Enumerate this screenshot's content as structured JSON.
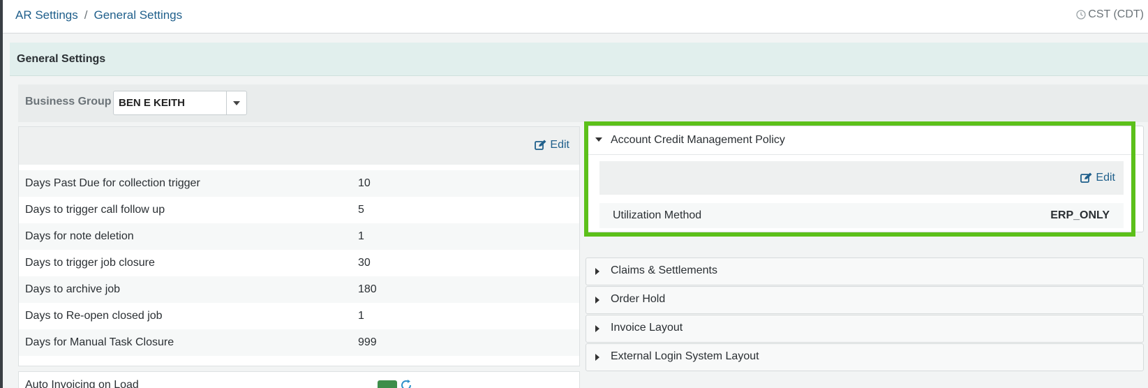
{
  "breadcrumb": {
    "root": "AR Settings",
    "separator": "/",
    "current": "General Settings"
  },
  "timezone": "CST (CDT)",
  "section_title": "General Settings",
  "business_group": {
    "label": "Business Group",
    "value": "BEN E KEITH"
  },
  "left_panel": {
    "edit_label": "Edit",
    "rows": [
      {
        "label": "Days Past Due for collection trigger",
        "value": "10"
      },
      {
        "label": "Days to trigger call follow up",
        "value": "5"
      },
      {
        "label": "Days for note deletion",
        "value": "1"
      },
      {
        "label": "Days to trigger job closure",
        "value": "30"
      },
      {
        "label": "Days to archive job",
        "value": "180"
      },
      {
        "label": "Days to Re-open closed job",
        "value": "1"
      },
      {
        "label": "Days for Manual Task Closure",
        "value": "999"
      }
    ],
    "partial_row_label": "Auto Invoicing on Load"
  },
  "accordions": {
    "account_credit": {
      "title": "Account Credit Management Policy",
      "edit_label": "Edit",
      "row_label": "Utilization Method",
      "row_value": "ERP_ONLY"
    },
    "claims": {
      "title": "Claims & Settlements"
    },
    "order_hold": {
      "title": "Order Hold"
    },
    "invoice_layout": {
      "title": "Invoice Layout"
    },
    "external_login": {
      "title": "External Login System Layout"
    }
  },
  "colors": {
    "link": "#1f5f8b",
    "highlight": "#5cc01a",
    "header_bg": "#e1efed"
  }
}
